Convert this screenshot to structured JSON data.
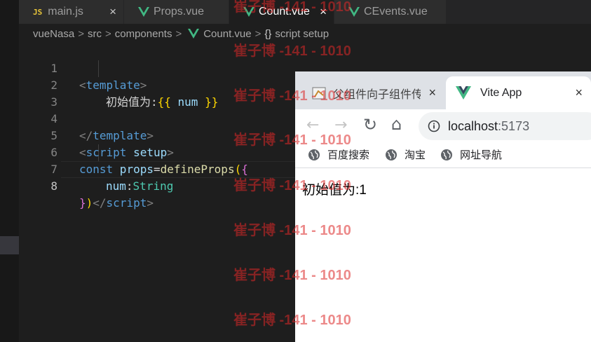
{
  "editor": {
    "tabs": [
      {
        "label": "main.js",
        "icon": "js-icon"
      },
      {
        "label": "Props.vue",
        "icon": "vue-icon"
      },
      {
        "label": "Count.vue",
        "icon": "vue-icon",
        "active": true
      },
      {
        "label": "CEvents.vue",
        "icon": "vue-icon"
      }
    ],
    "close_glyph": "×",
    "js_badge": "JS",
    "breadcrumb": {
      "items": [
        "vueNasa",
        "src",
        "components",
        "Count.vue"
      ],
      "separator": ">",
      "scope_icon": "{}",
      "scope": "script setup"
    },
    "line_numbers": [
      "1",
      "2",
      "3",
      "4",
      "5",
      "6",
      "7",
      "8"
    ],
    "current_line": "8",
    "code": {
      "l1": {
        "open": "<",
        "tag": "template",
        "close": ">"
      },
      "l2": {
        "text": "初始值为:",
        "lb": "{{",
        "expr": " num ",
        "rb": "}}"
      },
      "l4": {
        "open": "</",
        "tag": "template",
        "close": ">"
      },
      "l5": {
        "open": "<",
        "tag": "script",
        "attr": " setup",
        "close": ">"
      },
      "l6": {
        "kw": "const",
        "var": " props",
        "eq": "=",
        "fn": "defineProps",
        "p": "(",
        "b": "{"
      },
      "l7": {
        "prop": "num",
        "colon": ":",
        "type": "String"
      },
      "l8": {
        "b": "}",
        "p": ")",
        "open": "</",
        "tag": "script",
        "close": ">"
      }
    }
  },
  "browser": {
    "tabs": [
      {
        "label": "父组件向子组件传",
        "icon": "favicon-icon"
      },
      {
        "label": "Vite App",
        "icon": "vue-icon",
        "active": true
      }
    ],
    "close_glyph": "×",
    "nav": {
      "back": "←",
      "forward": "→",
      "reload": "↻",
      "home": "⌂"
    },
    "url": {
      "host": "localhost",
      "port": ":5173"
    },
    "bookmarks": [
      "百度搜索",
      "淘宝",
      "网址导航"
    ],
    "page_text": "初始值为:1"
  },
  "watermark": "崔子博 -141 - 1010",
  "colors": {
    "vue_green": "#41b883",
    "vue_dark": "#34495e",
    "watermark": "#dc2828"
  }
}
